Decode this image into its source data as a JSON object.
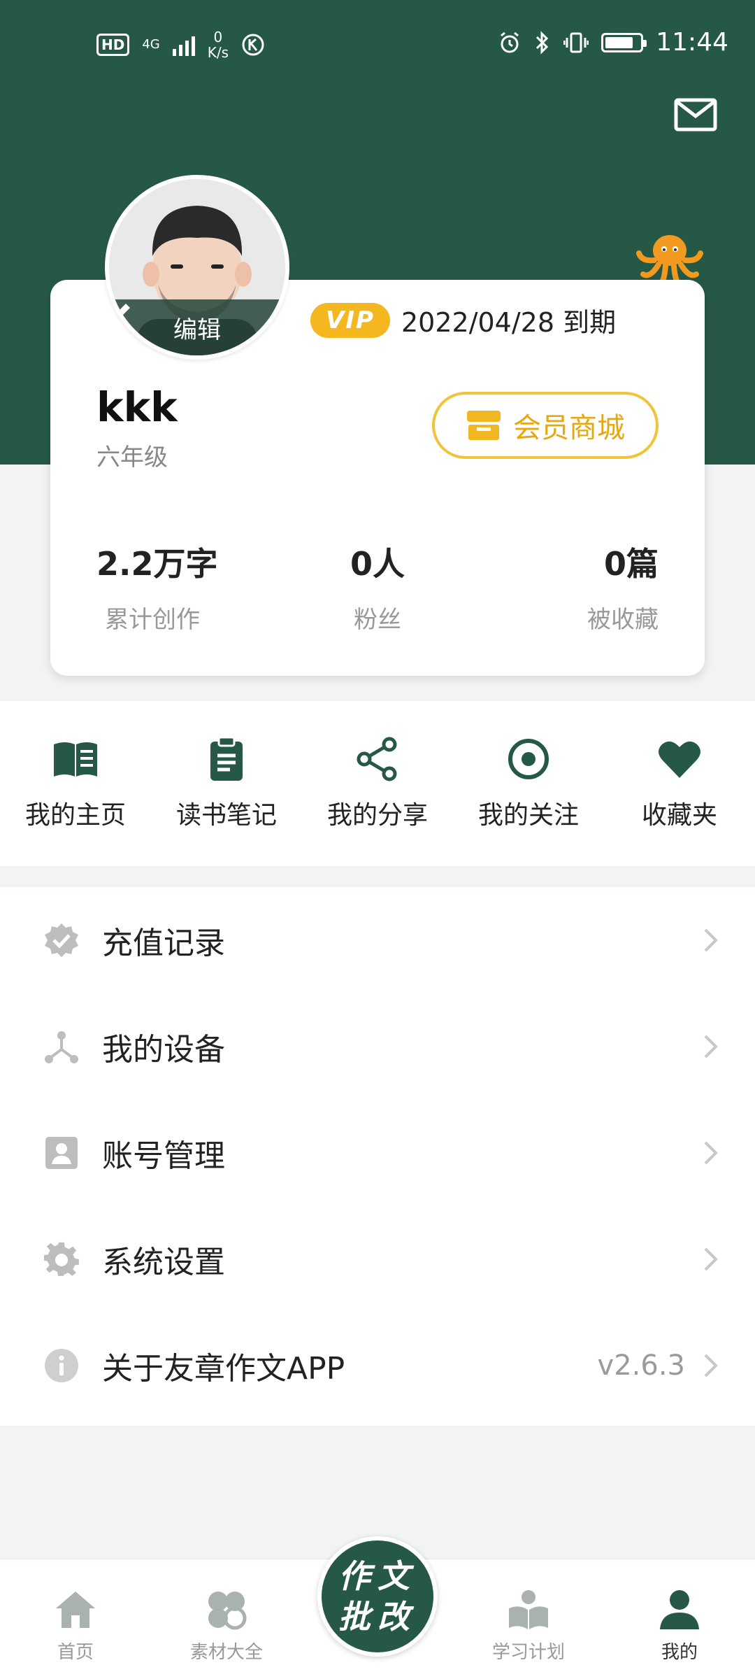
{
  "status_bar": {
    "hd_badge": "HD",
    "network_type": "4G",
    "speed_value": "0",
    "speed_unit": "K/s",
    "time": "11:44"
  },
  "profile": {
    "edit_label": "编辑",
    "vip_badge": "VIP",
    "vip_expiry": "2022/04/28 到期",
    "username": "kkk",
    "grade": "六年级",
    "shop_button": "会员商城",
    "stats": [
      {
        "value": "2.2万字",
        "label": "累计创作"
      },
      {
        "value": "0人",
        "label": "粉丝"
      },
      {
        "value": "0篇",
        "label": "被收藏"
      }
    ]
  },
  "shortcuts": [
    {
      "label": "我的主页",
      "icon": "book-icon"
    },
    {
      "label": "读书笔记",
      "icon": "clipboard-icon"
    },
    {
      "label": "我的分享",
      "icon": "share-icon"
    },
    {
      "label": "我的关注",
      "icon": "target-icon"
    },
    {
      "label": "收藏夹",
      "icon": "heart-icon"
    }
  ],
  "menu": [
    {
      "label": "充值记录",
      "icon": "verified-badge-icon",
      "extra": ""
    },
    {
      "label": "我的设备",
      "icon": "devices-icon",
      "extra": ""
    },
    {
      "label": "账号管理",
      "icon": "account-card-icon",
      "extra": ""
    },
    {
      "label": "系统设置",
      "icon": "gear-icon",
      "extra": ""
    },
    {
      "label": "关于友章作文APP",
      "icon": "info-icon",
      "extra": "v2.6.3"
    }
  ],
  "bottom_nav": {
    "items": [
      {
        "label": "首页",
        "icon": "home-icon"
      },
      {
        "label": "素材大全",
        "icon": "clover-icon"
      },
      {
        "label": "学习计划",
        "icon": "reading-icon"
      },
      {
        "label": "我的",
        "icon": "person-icon"
      }
    ],
    "center_button": "作文批改",
    "active": "我的"
  },
  "colors": {
    "brand_green": "#265945",
    "accent_gold": "#f4b720",
    "octopus_orange": "#f29a1f"
  }
}
